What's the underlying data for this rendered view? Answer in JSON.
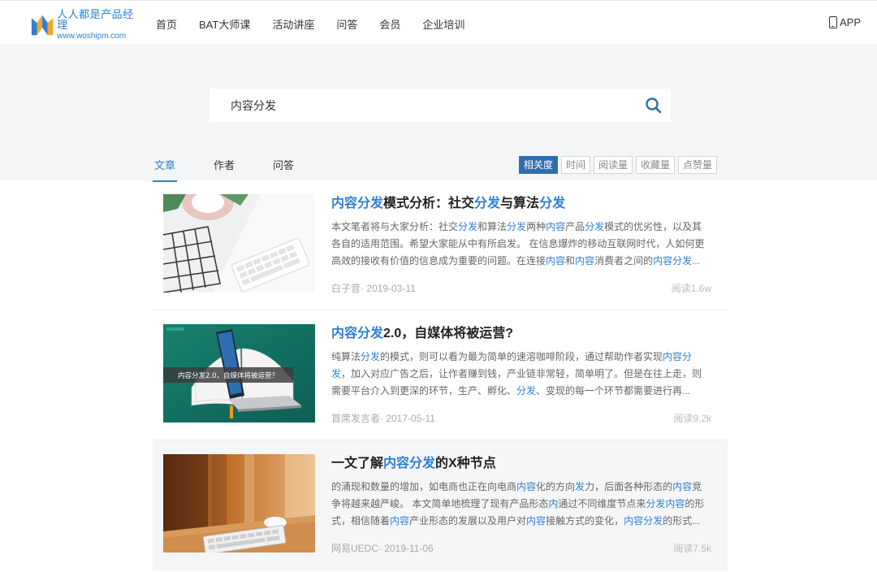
{
  "logo": {
    "cn": "人人都是产品经理",
    "en": "www.woshipm.com"
  },
  "nav": [
    "首页",
    "BAT大师课",
    "活动讲座",
    "问答",
    "会员",
    "企业培训"
  ],
  "app_label": "APP",
  "search": {
    "value": "内容分发"
  },
  "tabs": [
    "文章",
    "作者",
    "问答"
  ],
  "sort_options": [
    "相关度",
    "时间",
    "阅读量",
    "收藏量",
    "点赞量"
  ],
  "colors": {
    "accent": "#2f7fd6",
    "sort_active": "#2f6eae",
    "band": "#f4f5f7"
  },
  "results": [
    {
      "title": [
        [
          "内容分发",
          true
        ],
        [
          "模式分析：社交",
          false
        ],
        [
          "分发",
          true
        ],
        [
          "与算法",
          false
        ],
        [
          "分发",
          true
        ]
      ],
      "summary": [
        [
          "本文笔者将与大家分析：社交",
          false
        ],
        [
          "分发",
          true
        ],
        [
          "和算法",
          false
        ],
        [
          "分发",
          true
        ],
        [
          "两种",
          false
        ],
        [
          "内容",
          true
        ],
        [
          "产品",
          false
        ],
        [
          "分发",
          true
        ],
        [
          "模式的优劣性，以及其各自的适用范围。希望大家能从中有所启发。 在信息爆炸的移动互联网时代，人如何更高效的接收有价值的信息成为重要的问题。在连接",
          false
        ],
        [
          "内容",
          true
        ],
        [
          "和",
          false
        ],
        [
          "内容",
          true
        ],
        [
          "消费者之间的",
          false
        ],
        [
          "内容分发",
          true
        ],
        [
          "...",
          false
        ]
      ],
      "meta": "白子昔· 2019-03-11",
      "reads": "阅读1.6w"
    },
    {
      "title": [
        [
          "内容分发",
          true
        ],
        [
          "2.0，自媒体将被运营?",
          false
        ]
      ],
      "summary": [
        [
          "纯算法",
          false
        ],
        [
          "分发",
          true
        ],
        [
          "的模式，则可以看为最为简单的速溶咖啡阶段，通过帮助作者实现",
          false
        ],
        [
          "内容分发",
          true
        ],
        [
          "，加入对应广告之后，让作者赚到钱，产业链非常轻，简单明了。但是在往上走，则需要平台介入到更深的环节，生产、孵化、",
          false
        ],
        [
          "分发",
          true
        ],
        [
          "、变现的每一个环节都需要进行再...",
          false
        ]
      ],
      "meta": "首席发言者· 2017-05-11",
      "reads": "阅读9.2k",
      "thumb_caption": "内容分发2.0，自媒体将被运营？"
    },
    {
      "title": [
        [
          "一文了解",
          false
        ],
        [
          "内容分发",
          true
        ],
        [
          "的X种节点",
          false
        ]
      ],
      "summary": [
        [
          "的涌现和数量的增加，如电商也正在向电商",
          false
        ],
        [
          "内容",
          true
        ],
        [
          "化的方向",
          false
        ],
        [
          "发",
          true
        ],
        [
          "力，后面各种形态的",
          false
        ],
        [
          "内容",
          true
        ],
        [
          "竞争将越来越严峻。 本文简单地梳理了现有产品形态",
          false
        ],
        [
          "内",
          true
        ],
        [
          "通过不同维度节点来",
          false
        ],
        [
          "分发内容",
          true
        ],
        [
          "的形式，相信随着",
          false
        ],
        [
          "内容",
          true
        ],
        [
          "产业形态的发展以及用户对",
          false
        ],
        [
          "内容",
          true
        ],
        [
          "接触方式的变化，",
          false
        ],
        [
          "内容分发",
          true
        ],
        [
          "的形式...",
          false
        ]
      ],
      "meta": "网易UEDC· 2019-11-06",
      "reads": "阅读7.5k"
    }
  ]
}
